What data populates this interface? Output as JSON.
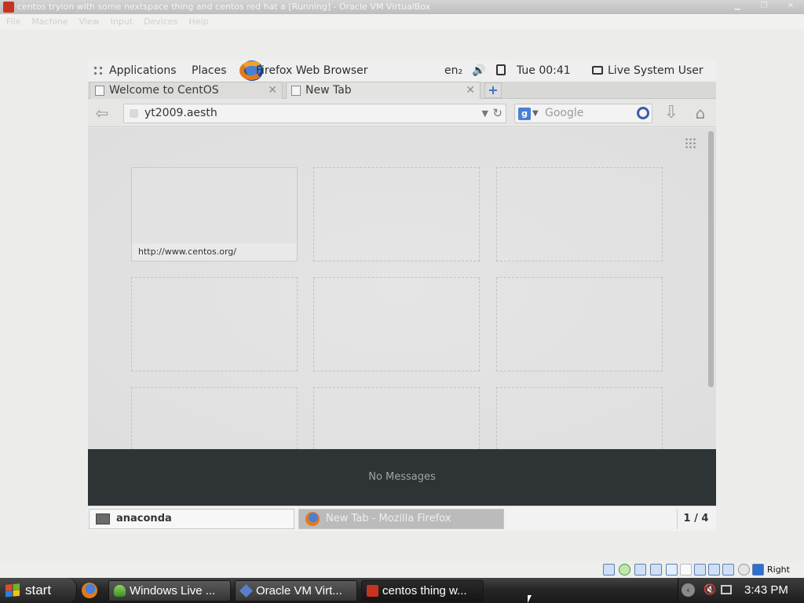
{
  "host_window": {
    "title": "centos tryion with some nextspace thing and centos red hat a [Running] - Oracle VM VirtualBox",
    "menu": [
      "File",
      "Machine",
      "View",
      "Input",
      "Devices",
      "Help"
    ]
  },
  "guest": {
    "top_panel": {
      "applications": "Applications",
      "places": "Places",
      "active_app": "Firefox Web Browser",
      "keyboard_layout": "en₂",
      "clock": "Tue 00:41",
      "user": "Live System User"
    },
    "browser": {
      "tabs": [
        {
          "label": "Welcome to CentOS"
        },
        {
          "label": "New Tab"
        }
      ],
      "url": "yt2009.aesth",
      "search_placeholder": "Google",
      "search_engine_icon": "g",
      "tiles": [
        {
          "url": "http://www.centos.org/"
        }
      ]
    },
    "message_tray": "No Messages",
    "bottom_panel": {
      "tasks": [
        "anaconda",
        "New Tab - Mozilla Firefox"
      ],
      "workspace": "1 / 4"
    }
  },
  "vbox_status": {
    "host_key": "Right Ctrl"
  },
  "xp_taskbar": {
    "start_label": "start",
    "tasks": [
      "Windows Live ...",
      "Oracle VM Virt...",
      "centos thing w..."
    ],
    "clock": "3:43 PM"
  },
  "icons": {
    "window_controls": [
      "minimize-icon",
      "maximize-icon",
      "close-icon"
    ],
    "tray": [
      "tray-expand-icon",
      "volume-muted-icon",
      "network-icon"
    ]
  }
}
